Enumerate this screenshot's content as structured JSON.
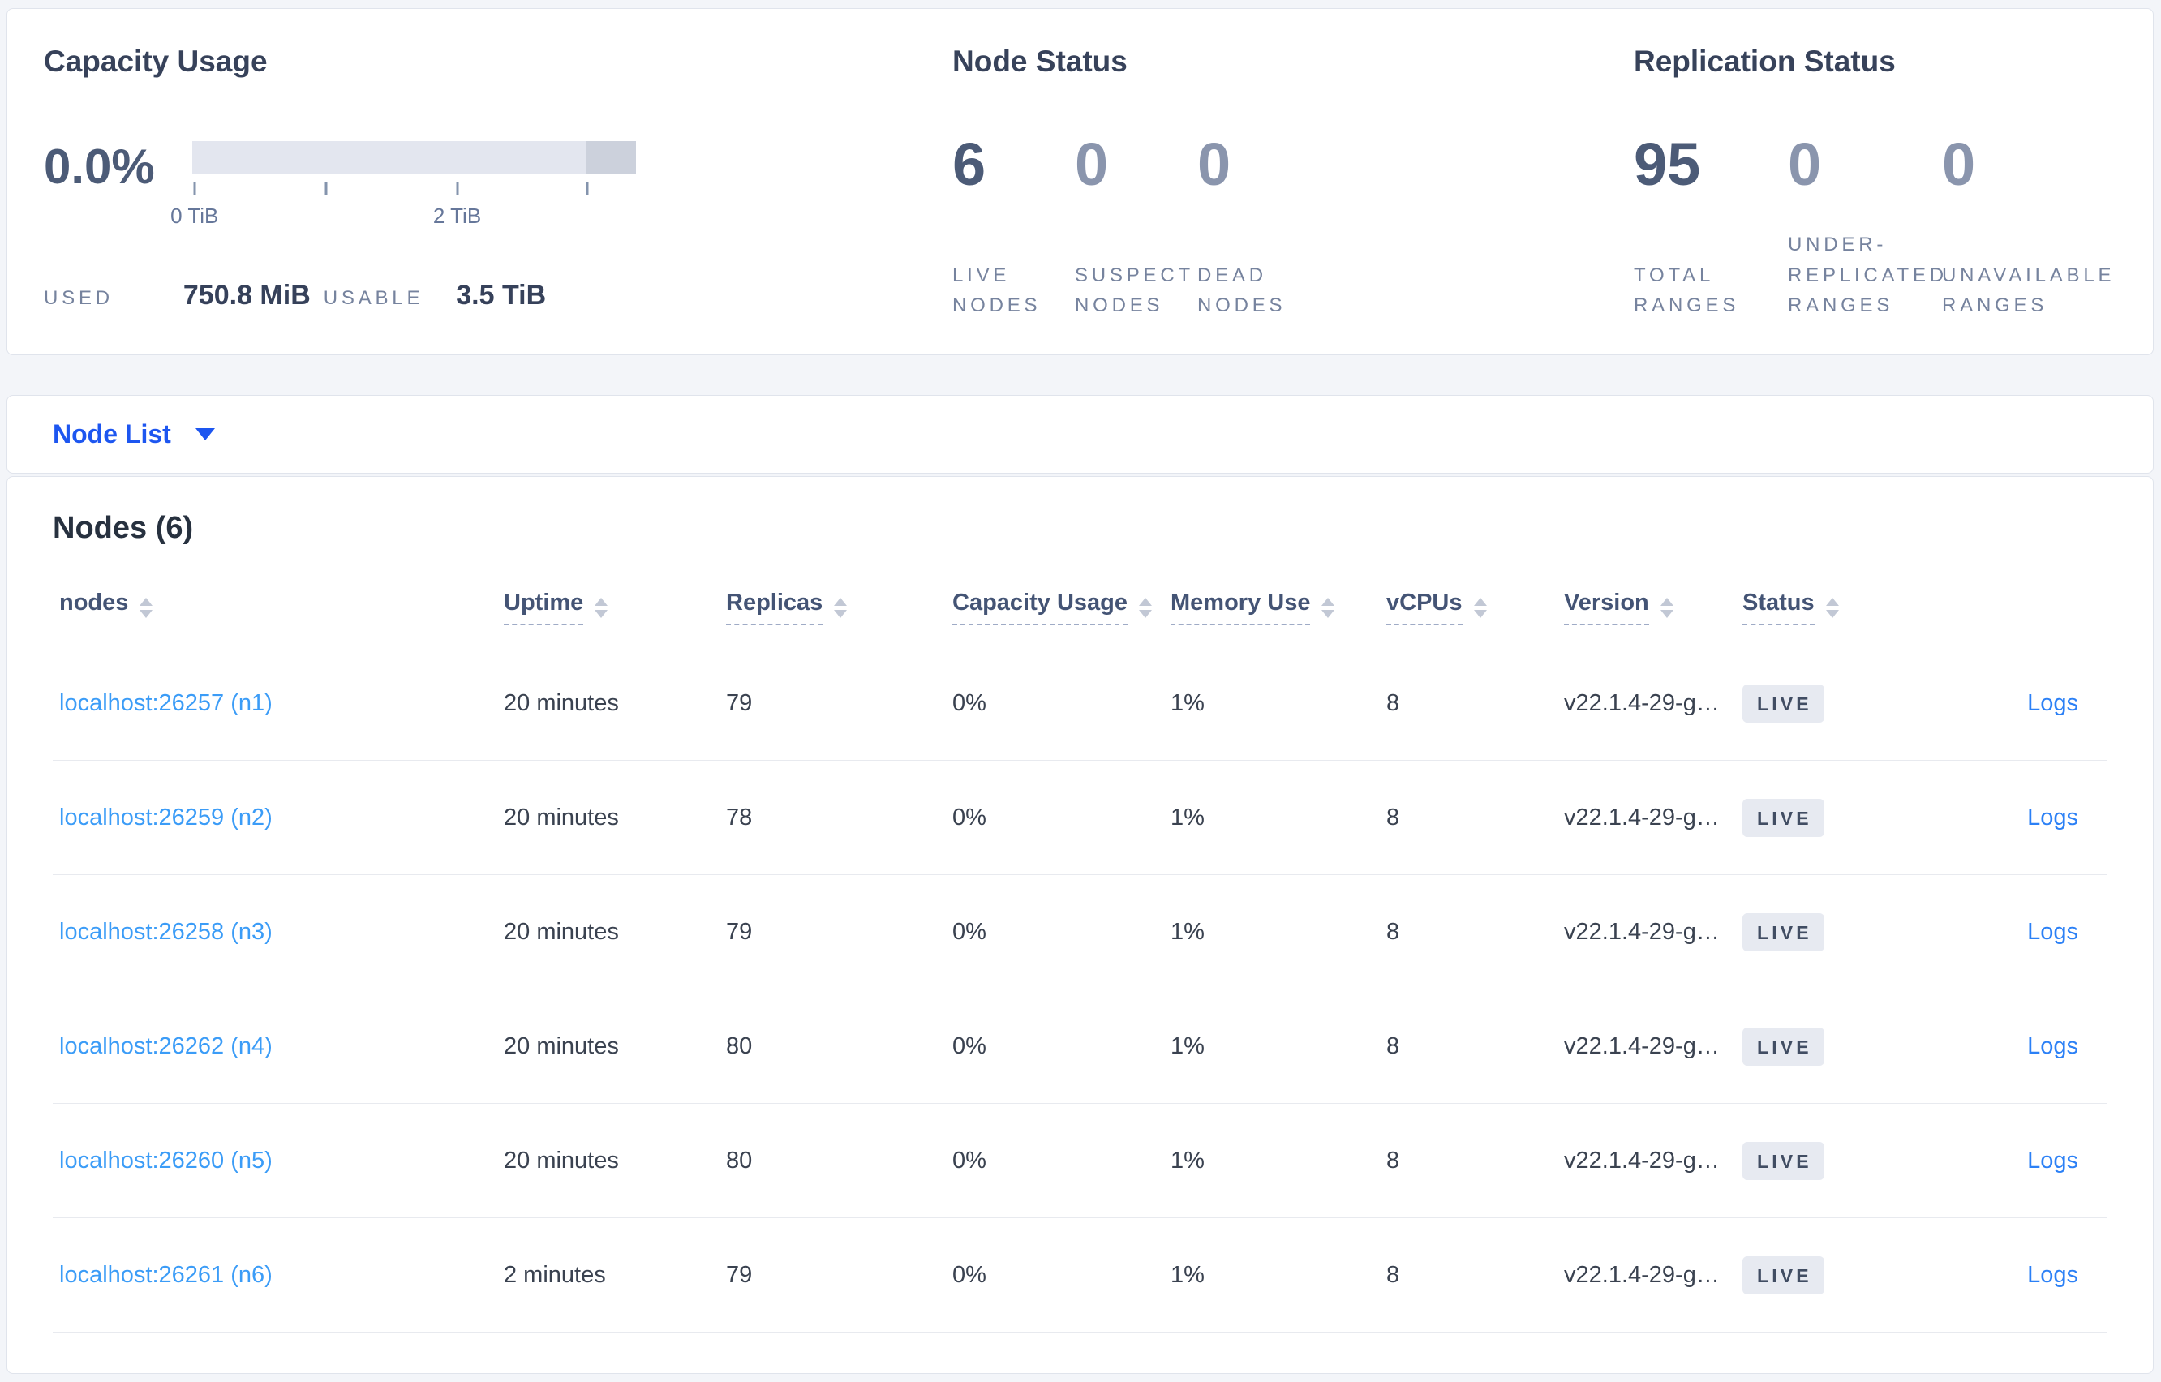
{
  "colors": {
    "accent_blue": "#1d56f0",
    "node_link_blue": "#3b9cf7",
    "logs_link_blue": "#2b80f6",
    "primary_number": "#4c5b77",
    "muted_number": "#8a95ad",
    "live_badge_bg": "#e7eaf1",
    "bar_light": "#e3e6ef",
    "bar_dark": "#ccd1dc"
  },
  "summary": {
    "capacity": {
      "title": "Capacity Usage",
      "percent": "0.0%",
      "tick_label_0": "0 TiB",
      "tick_label_2": "2 TiB",
      "used_label": "USED",
      "used_value": "750.8 MiB",
      "usable_label": "USABLE",
      "usable_value": "3.5 TiB"
    },
    "node_status": {
      "title": "Node Status",
      "metrics": [
        {
          "value": "6",
          "label": "LIVE NODES"
        },
        {
          "value": "0",
          "label": "SUSPECT NODES"
        },
        {
          "value": "0",
          "label": "DEAD NODES"
        }
      ]
    },
    "replication": {
      "title": "Replication Status",
      "metrics": [
        {
          "value": "95",
          "label": "TOTAL RANGES"
        },
        {
          "value": "0",
          "label": "UNDER-REPLICATED RANGES"
        },
        {
          "value": "0",
          "label": "UNAVAILABLE RANGES"
        }
      ]
    }
  },
  "node_list": {
    "selector_label": "Node List",
    "heading": "Nodes (6)"
  },
  "table": {
    "columns": [
      {
        "label": "nodes"
      },
      {
        "label": "Uptime"
      },
      {
        "label": "Replicas"
      },
      {
        "label": "Capacity Usage"
      },
      {
        "label": "Memory Use"
      },
      {
        "label": "vCPUs"
      },
      {
        "label": "Version"
      },
      {
        "label": "Status"
      }
    ],
    "rows": [
      {
        "node": "localhost:26257 (n1)",
        "uptime": "20 minutes",
        "replicas": "79",
        "capacity": "0%",
        "memory": "1%",
        "vcpus": "8",
        "version": "v22.1.4-29-g…",
        "status": "LIVE",
        "logs": "Logs"
      },
      {
        "node": "localhost:26259 (n2)",
        "uptime": "20 minutes",
        "replicas": "78",
        "capacity": "0%",
        "memory": "1%",
        "vcpus": "8",
        "version": "v22.1.4-29-g…",
        "status": "LIVE",
        "logs": "Logs"
      },
      {
        "node": "localhost:26258 (n3)",
        "uptime": "20 minutes",
        "replicas": "79",
        "capacity": "0%",
        "memory": "1%",
        "vcpus": "8",
        "version": "v22.1.4-29-g…",
        "status": "LIVE",
        "logs": "Logs"
      },
      {
        "node": "localhost:26262 (n4)",
        "uptime": "20 minutes",
        "replicas": "80",
        "capacity": "0%",
        "memory": "1%",
        "vcpus": "8",
        "version": "v22.1.4-29-g…",
        "status": "LIVE",
        "logs": "Logs"
      },
      {
        "node": "localhost:26260 (n5)",
        "uptime": "20 minutes",
        "replicas": "80",
        "capacity": "0%",
        "memory": "1%",
        "vcpus": "8",
        "version": "v22.1.4-29-g…",
        "status": "LIVE",
        "logs": "Logs"
      },
      {
        "node": "localhost:26261 (n6)",
        "uptime": "2 minutes",
        "replicas": "79",
        "capacity": "0%",
        "memory": "1%",
        "vcpus": "8",
        "version": "v22.1.4-29-g…",
        "status": "LIVE",
        "logs": "Logs"
      }
    ]
  }
}
